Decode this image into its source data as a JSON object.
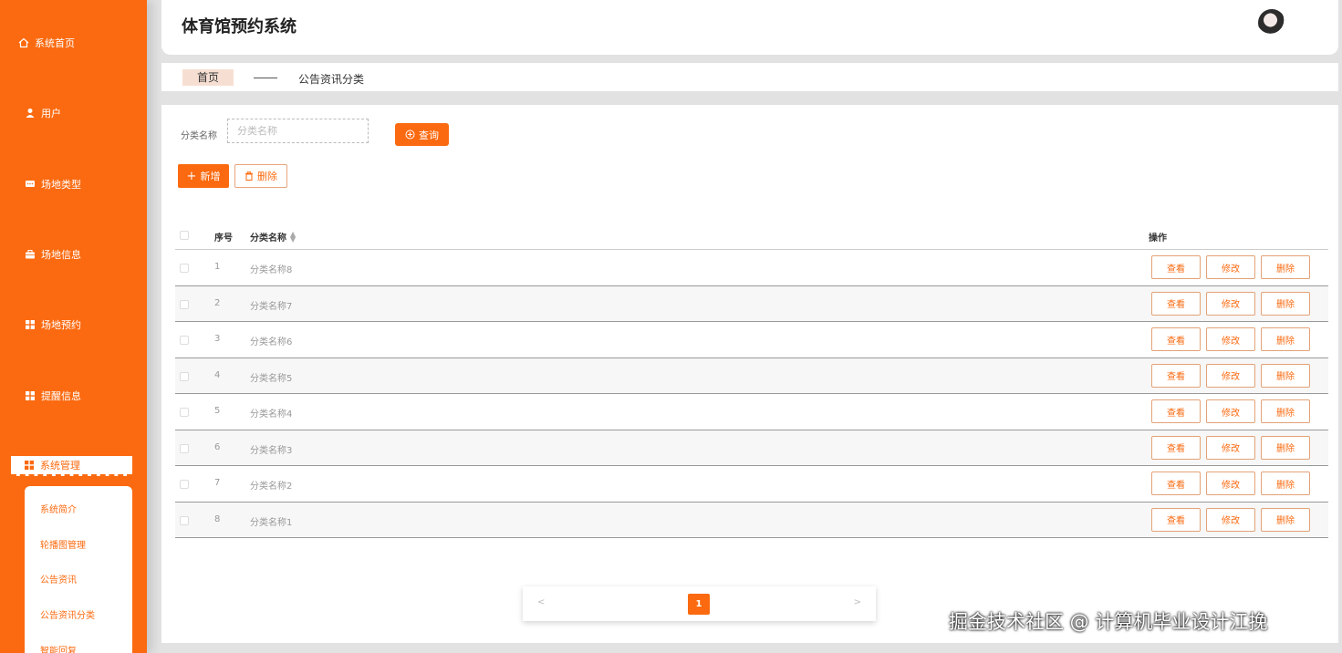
{
  "app": {
    "title": "体育馆预约系统"
  },
  "sidebar": {
    "items": [
      {
        "label": "系统首页",
        "icon": "home-icon"
      },
      {
        "label": "用户",
        "icon": "user-icon"
      },
      {
        "label": "场地类型",
        "icon": "chat-icon"
      },
      {
        "label": "场地信息",
        "icon": "briefcase-icon"
      },
      {
        "label": "场地预约",
        "icon": "grid-icon"
      },
      {
        "label": "提醒信息",
        "icon": "grid-icon"
      },
      {
        "label": "系统管理",
        "icon": "grid-icon"
      }
    ],
    "submenu": [
      {
        "label": "系统简介"
      },
      {
        "label": "轮播图管理"
      },
      {
        "label": "公告资讯"
      },
      {
        "label": "公告资讯分类"
      },
      {
        "label": "智能回复"
      }
    ],
    "accent": "#fb6a10"
  },
  "breadcrumb": {
    "home": "首页",
    "current": "公告资讯分类"
  },
  "search": {
    "label": "分类名称",
    "placeholder": "分类名称",
    "query_button": "查询"
  },
  "toolbar": {
    "add_label": "新增",
    "delete_label": "删除"
  },
  "table": {
    "headers": {
      "index": "序号",
      "name": "分类名称",
      "ops": "操作"
    },
    "rows": [
      {
        "index": "1",
        "name": "分类名称8"
      },
      {
        "index": "2",
        "name": "分类名称7"
      },
      {
        "index": "3",
        "name": "分类名称6"
      },
      {
        "index": "4",
        "name": "分类名称5"
      },
      {
        "index": "5",
        "name": "分类名称4"
      },
      {
        "index": "6",
        "name": "分类名称3"
      },
      {
        "index": "7",
        "name": "分类名称2"
      },
      {
        "index": "8",
        "name": "分类名称1"
      }
    ],
    "actions": {
      "view": "查看",
      "edit": "修改",
      "delete": "删除"
    }
  },
  "pagination": {
    "prev": "<",
    "current": "1",
    "next": ">"
  },
  "watermark": "掘金技术社区 @ 计算机毕业设计江挽"
}
